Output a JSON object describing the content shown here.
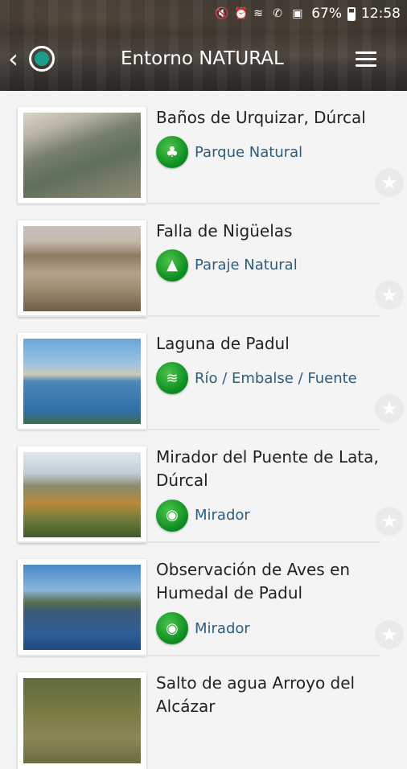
{
  "status": {
    "battery": "67%",
    "time": "12:58"
  },
  "appbar": {
    "title": "Entorno NATURAL"
  },
  "items": [
    {
      "name": "Baños de Urquizar, Dúrcal",
      "category": "Parque Natural",
      "icon": "trees-icon"
    },
    {
      "name": "Falla de Nigüelas",
      "category": "Paraje Natural",
      "icon": "pine-trees-icon"
    },
    {
      "name": "Laguna de Padul",
      "category": "Río / Embalse / Fuente",
      "icon": "water-waves-icon"
    },
    {
      "name": "Mirador del Puente de Lata, Dúrcal",
      "category": "Mirador",
      "icon": "binoculars-icon"
    },
    {
      "name": "Observación de Aves en Humedal de Padul",
      "category": "Mirador",
      "icon": "binoculars-icon"
    },
    {
      "name": "Salto de agua Arroyo del Alcázar",
      "category": "",
      "icon": ""
    }
  ],
  "colors": {
    "category_green": "#0a8a1e",
    "category_text": "#2e5c7a"
  }
}
